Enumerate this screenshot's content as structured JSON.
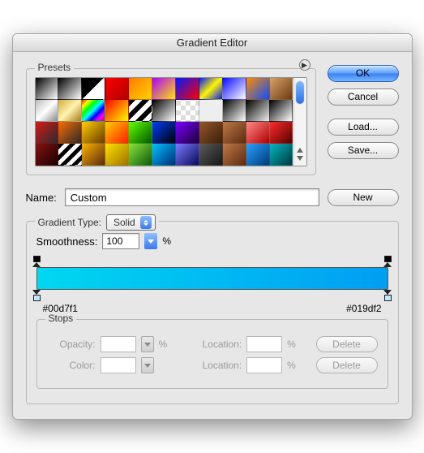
{
  "title": "Gradient Editor",
  "buttons": {
    "ok": "OK",
    "cancel": "Cancel",
    "load": "Load...",
    "save": "Save...",
    "new": "New",
    "delete": "Delete"
  },
  "presets": {
    "legend": "Presets",
    "swatches": [
      "linear-gradient(135deg,#000,#fff)",
      "linear-gradient(135deg,#000,#fff)",
      "linear-gradient(135deg,#000 0%,#000 49%,transparent 50%)",
      "linear-gradient(135deg,#ff0000,#b10000)",
      "linear-gradient(135deg,#ff7a00,#ffd300)",
      "linear-gradient(135deg,#aa00ff,#ffe600)",
      "linear-gradient(135deg,#0018ff,#ff0000)",
      "linear-gradient(135deg,#0018ff,#fff600,#001aff)",
      "linear-gradient(135deg,#0a0aff,#fff)",
      "linear-gradient(135deg,#ff8b00,#0b4dff)",
      "linear-gradient(135deg,#d9a26a,#6b3a12)",
      "linear-gradient(135deg,#bbb,#fff,#888)",
      "linear-gradient(135deg,#d4af37,#fff3b0,#a87b17)",
      "linear-gradient(135deg,#f00,#ff0,#0f0,#0ff,#00f,#f0f,#f00)",
      "linear-gradient(135deg,#f00,#ff0)",
      "repeating-linear-gradient(135deg,#000 0 6px,#fff 6px 12px)",
      "linear-gradient(135deg,#000,#fff)",
      "repeating-conic-gradient(#ddd 0 25%,#fff 0 50%) 0/12px 12px",
      "linear-gradient(135deg,#eee,#eee)",
      "linear-gradient(135deg,#000,#fff)",
      "linear-gradient(135deg,#000,#eee)",
      "linear-gradient(135deg,#000,#fff)",
      "linear-gradient(135deg,#d61818,#2a2a2a)",
      "linear-gradient(135deg,#ff6a00,#2a2a2a)",
      "linear-gradient(135deg,#ffcf00,#6a3a00)",
      "linear-gradient(135deg,#ffcf00,#ff1e00)",
      "linear-gradient(135deg,#62ff00,#005800)",
      "linear-gradient(135deg,#003cff,#000)",
      "linear-gradient(135deg,#7a00ff,#1a003a)",
      "linear-gradient(135deg,#95572a,#3b1f0a)",
      "linear-gradient(135deg,#c07848,#5a2c10)",
      "linear-gradient(135deg,#ff8a8a,#b10000)",
      "linear-gradient(135deg,#ff2a2a,#560000)",
      "linear-gradient(135deg,#871212,#1a0000)",
      "repeating-linear-gradient(135deg,#000 0 5px,#fff 5px 10px)",
      "linear-gradient(135deg,#ffb100,#5a2c10)",
      "linear-gradient(135deg,#ffe100,#a07300)",
      "linear-gradient(135deg,#8de23e,#0a5c0a)",
      "linear-gradient(135deg,#00c2ff,#002d7a)",
      "linear-gradient(135deg,#7a7aff,#0a0a5a)",
      "linear-gradient(135deg,#5a5a5a,#171717)",
      "linear-gradient(135deg,#c07848,#5a2c10)",
      "linear-gradient(135deg,#2aa0ff,#003b7a)",
      "linear-gradient(135deg,#00b7c2,#003a3e)"
    ]
  },
  "name": {
    "label": "Name:",
    "value": "Custom"
  },
  "gradientType": {
    "label": "Gradient Type:",
    "value": "Solid"
  },
  "smoothness": {
    "label": "Smoothness:",
    "value": "100",
    "unit": "%"
  },
  "gradient": {
    "css": "linear-gradient(90deg,#00d7f1,#019df2)",
    "leftHex": "#00d7f1",
    "rightHex": "#019df2"
  },
  "stops": {
    "legend": "Stops",
    "opacityLabel": "Opacity:",
    "colorLabel": "Color:",
    "locationLabel": "Location:",
    "pct": "%"
  }
}
